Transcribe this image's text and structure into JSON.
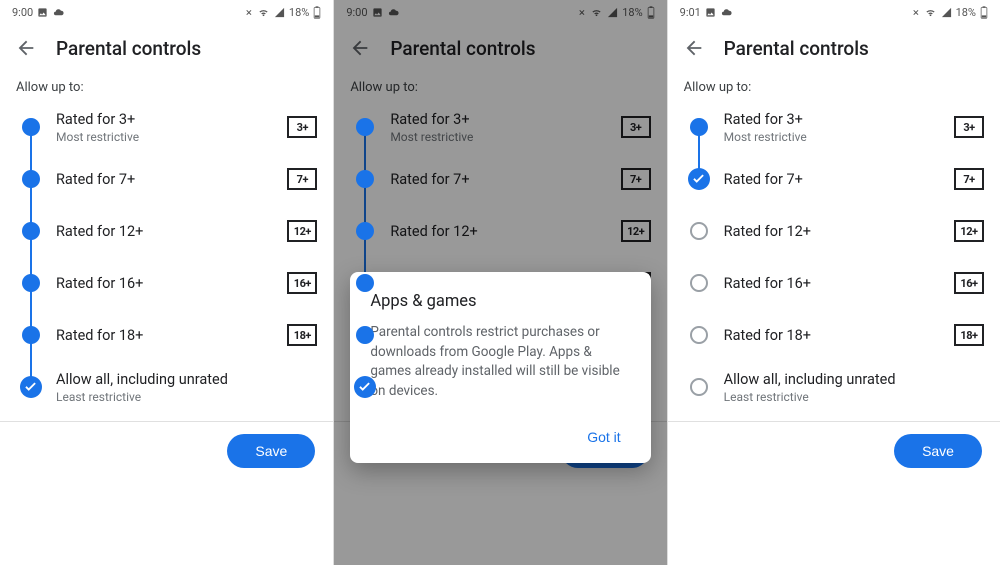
{
  "status": {
    "time_a": "9:00",
    "time_b": "9:00",
    "time_c": "9:01",
    "battery_pct": "18%"
  },
  "appbar": {
    "title": "Parental controls"
  },
  "section_label": "Allow up to:",
  "ratings": [
    {
      "label": "Rated for 3+",
      "sub": "Most restrictive",
      "badge": "3+"
    },
    {
      "label": "Rated for 7+",
      "sub": "",
      "badge": "7+"
    },
    {
      "label": "Rated for 12+",
      "sub": "",
      "badge": "12+"
    },
    {
      "label": "Rated for 16+",
      "sub": "",
      "badge": "16+"
    },
    {
      "label": "Rated for 18+",
      "sub": "",
      "badge": "18+"
    },
    {
      "label": "Allow all, including unrated",
      "sub": "Least restrictive",
      "badge": ""
    }
  ],
  "save_label": "Save",
  "dialog": {
    "title": "Apps & games",
    "body": "Parental controls restrict purchases or downloads from Google Play. Apps & games already installed will still be visible on devices.",
    "confirm": "Got it"
  },
  "screens": {
    "a": {
      "selected_index": 5
    },
    "b": {
      "selected_index": 5,
      "dialog": true
    },
    "c": {
      "selected_index": 1
    }
  },
  "colors": {
    "accent": "#1a73e8"
  }
}
